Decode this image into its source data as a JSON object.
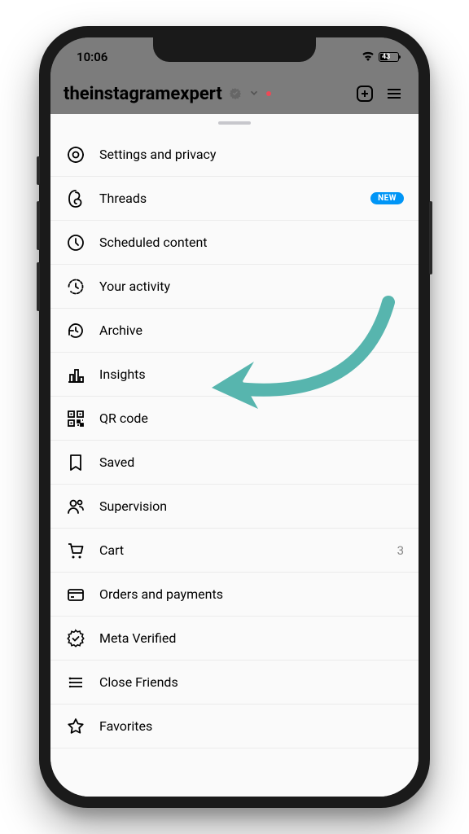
{
  "status": {
    "time": "10:06",
    "battery_pct": "43"
  },
  "header": {
    "username": "theinstagramexpert"
  },
  "menu": {
    "items": [
      {
        "label": "Settings and privacy",
        "icon": "gear-icon",
        "badge": null,
        "count": null
      },
      {
        "label": "Threads",
        "icon": "threads-icon",
        "badge": "NEW",
        "count": null
      },
      {
        "label": "Scheduled content",
        "icon": "clock-icon",
        "badge": null,
        "count": null
      },
      {
        "label": "Your activity",
        "icon": "activity-icon",
        "badge": null,
        "count": null
      },
      {
        "label": "Archive",
        "icon": "archive-icon",
        "badge": null,
        "count": null
      },
      {
        "label": "Insights",
        "icon": "insights-icon",
        "badge": null,
        "count": null
      },
      {
        "label": "QR code",
        "icon": "qr-icon",
        "badge": null,
        "count": null
      },
      {
        "label": "Saved",
        "icon": "bookmark-icon",
        "badge": null,
        "count": null
      },
      {
        "label": "Supervision",
        "icon": "supervision-icon",
        "badge": null,
        "count": null
      },
      {
        "label": "Cart",
        "icon": "cart-icon",
        "badge": null,
        "count": "3"
      },
      {
        "label": "Orders and payments",
        "icon": "card-icon",
        "badge": null,
        "count": null
      },
      {
        "label": "Meta Verified",
        "icon": "verified-icon",
        "badge": null,
        "count": null
      },
      {
        "label": "Close Friends",
        "icon": "close-friends-icon",
        "badge": null,
        "count": null
      },
      {
        "label": "Favorites",
        "icon": "star-icon",
        "badge": null,
        "count": null
      }
    ]
  },
  "annotation": {
    "arrow_color": "#57b5ae"
  }
}
